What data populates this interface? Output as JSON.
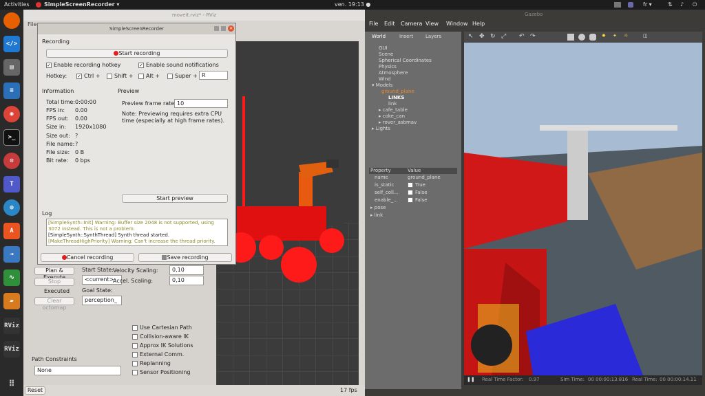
{
  "topbar": {
    "activities": "Activities",
    "app_name": "SimpleScreenRecorder ▾",
    "clock": "ven. 19:13 ●",
    "lang": "fr ▾"
  },
  "rviz": {
    "title": "moveit.rviz* - RViz",
    "menu_file": "File",
    "fps": "17 fps",
    "reset_label": "Reset",
    "plan_execute": "Plan & Execute",
    "execute": "Executed",
    "stop": "Stop",
    "clear_octomap": "Clear octomap",
    "start_state_label": "Start State:",
    "start_state_value": "<current>",
    "goal_state_label": "Goal State:",
    "goal_state_value": "perception_",
    "velocity_label": "Velocity Scaling:",
    "velocity_value": "0,10",
    "accel_label": "Accel. Scaling:",
    "accel_value": "0,10",
    "options": [
      "Use Cartesian Path",
      "Collision-aware IK",
      "Approx IK Solutions",
      "External Comm.",
      "Replanning",
      "Sensor Positioning"
    ],
    "path_constraints_label": "Path Constraints",
    "path_constraints_value": "None"
  },
  "ssr": {
    "title": "SimpleScreenRecorder",
    "recording_section": "Recording",
    "start_recording": "Start recording",
    "enable_hotkey": "Enable recording hotkey",
    "enable_sound": "Enable sound notifications",
    "hotkey_label": "Hotkey:",
    "ctrl": "Ctrl +",
    "shift": "Shift +",
    "alt": "Alt +",
    "super": "Super +",
    "key_value": "R",
    "info_section": "Information",
    "info_rows": [
      {
        "k": "Total time:",
        "v": "0:00:00"
      },
      {
        "k": "FPS in:",
        "v": "0.00"
      },
      {
        "k": "FPS out:",
        "v": "0.00"
      },
      {
        "k": "Size in:",
        "v": "1920x1080"
      },
      {
        "k": "Size out:",
        "v": "?"
      },
      {
        "k": "File name:",
        "v": "?"
      },
      {
        "k": "File size:",
        "v": "0 B"
      },
      {
        "k": "Bit rate:",
        "v": "0 bps"
      }
    ],
    "preview_section": "Preview",
    "preview_rate_label": "Preview frame rate:",
    "preview_rate_value": "10",
    "preview_note": "Note: Previewing requires extra CPU time (especially at high frame rates).",
    "start_preview": "Start preview",
    "log_section": "Log",
    "log_lines": [
      "[SimpleSynth::Init] Warning: Buffer size 2048 is not supported, using",
      "3072 instead. This is not a problem.",
      "[SimpleSynth::SynthThread] Synth thread started.",
      "[MakeThreadHighPriority] Warning: Can't increase the thread priority."
    ],
    "cancel_recording": "Cancel recording",
    "save_recording": "Save recording"
  },
  "gazebo": {
    "title": "Gazebo",
    "menu": [
      "File",
      "Edit",
      "Camera",
      "View",
      "Window",
      "Help"
    ],
    "tabs": [
      "World",
      "Insert",
      "Layers"
    ],
    "tree": [
      "GUI",
      "Scene",
      "Spherical Coordinates",
      "Physics",
      "Atmosphere",
      "Wind",
      "Models",
      "ground_plane",
      "LINKS",
      "link",
      "cafe_table",
      "coke_can",
      "rover_asbmav",
      "Lights"
    ],
    "prop_header": [
      "Property",
      "Value"
    ],
    "props": [
      {
        "k": "name",
        "v": "ground_plane"
      },
      {
        "k": "is_static",
        "v": "True"
      },
      {
        "k": "self_coll...",
        "v": "False"
      },
      {
        "k": "enable_...",
        "v": "False"
      },
      {
        "k": "pose",
        "v": ""
      },
      {
        "k": "link",
        "v": ""
      }
    ],
    "status_real_time_factor_label": "Real Time Factor:",
    "status_real_time_factor": "0.97",
    "status_sim_time_label": "Sim Time:",
    "status_sim_time": "00 00:00:13.816",
    "status_real_time_label": "Real Time:",
    "status_real_time": "00 00:00:14.11"
  }
}
